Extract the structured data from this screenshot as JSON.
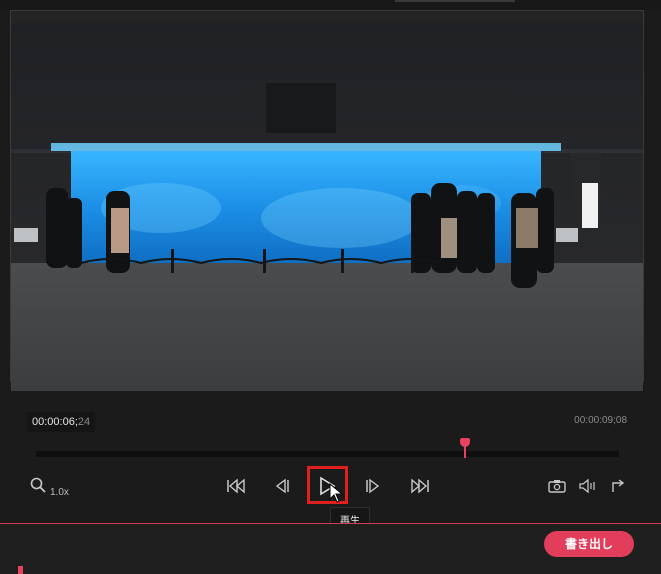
{
  "player": {
    "current_time_main": "00:00:06;",
    "current_time_frames": "24",
    "total_time": "00:00:09;08",
    "playback_progress": 0.735,
    "zoom_label": "1.0x"
  },
  "controls": [
    {
      "name": "zoom-icon"
    },
    {
      "name": "skip-to-start-icon"
    },
    {
      "name": "previous-frame-icon"
    },
    {
      "name": "play-icon"
    },
    {
      "name": "next-frame-icon"
    },
    {
      "name": "skip-to-end-icon"
    },
    {
      "name": "camera-icon"
    },
    {
      "name": "volume-icon"
    },
    {
      "name": "export-arrow-icon"
    }
  ],
  "tooltip": {
    "play": "再生"
  },
  "footer": {
    "export_label": "書き出し"
  },
  "colors": {
    "accent": "#e23d5a",
    "highlight_box": "#e0201f",
    "aquarium": "#1f8fe0"
  }
}
